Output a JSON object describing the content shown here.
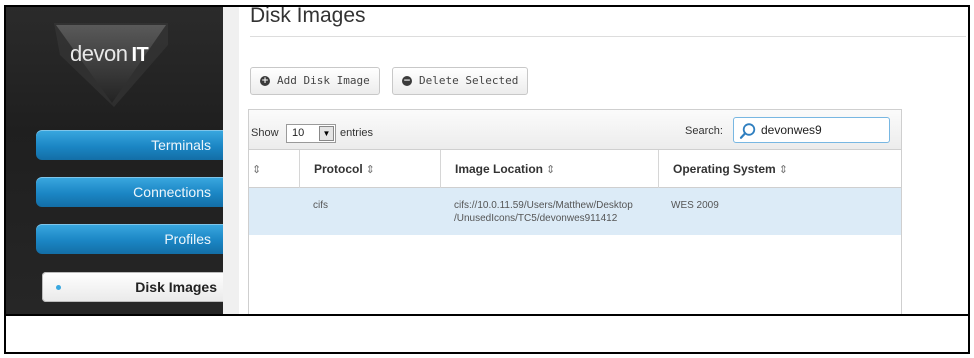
{
  "app": {
    "logo_text": "devon",
    "logo_suffix": "IT"
  },
  "sidebar": {
    "items": [
      {
        "label": "Terminals",
        "active": false
      },
      {
        "label": "Connections",
        "active": false
      },
      {
        "label": "Profiles",
        "active": false
      },
      {
        "label": "Disk Images",
        "active": true
      }
    ]
  },
  "page": {
    "title": "Disk Images"
  },
  "actions": {
    "add_label": "Add Disk Image",
    "delete_label": "Delete Selected"
  },
  "table_controls": {
    "show_label": "Show",
    "entries_value": "10",
    "entries_label": "entries",
    "search_label": "Search:",
    "search_value": "devonwes9"
  },
  "table": {
    "columns": [
      {
        "label": "",
        "sort": "⇕"
      },
      {
        "label": "Protocol",
        "sort": "⇕"
      },
      {
        "label": "Image Location",
        "sort": "⇕"
      },
      {
        "label": "Operating System",
        "sort": "⇕"
      }
    ],
    "rows": [
      {
        "protocol": "cifs",
        "location_line1": "cifs://10.0.11.59/Users/Matthew/Desktop",
        "location_line2": "/UnusedIcons/TC5/devonwes911412",
        "os": "WES 2009"
      }
    ]
  },
  "colors": {
    "nav_blue": "#1b86c4",
    "row_highlight": "#dcebf7",
    "search_border": "#78b7e2"
  }
}
